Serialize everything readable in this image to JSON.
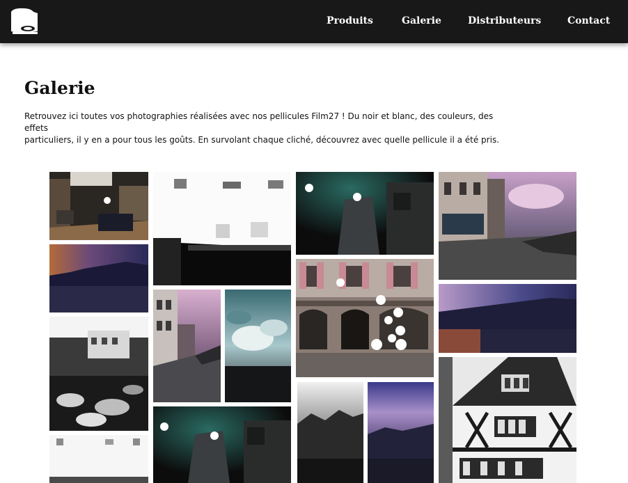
{
  "header": {
    "logo_name": "film27-logo",
    "nav": [
      {
        "label": "Produits"
      },
      {
        "label": "Galerie"
      },
      {
        "label": "Distributeurs"
      },
      {
        "label": "Contact"
      }
    ]
  },
  "page": {
    "title": "Galerie",
    "intro_line1": "Retrouvez ici toutes vos photographies réalisées avec nos pellicules Film27 ! Du noir et blanc, des couleurs, des effets",
    "intro_line2": "particuliers, il y en a pour tous les goûts. En survolant chaque cliché, découvrez avec quelle pellicule il a été pris."
  },
  "gallery": {
    "photos": [
      {
        "subject": "interior-room-color"
      },
      {
        "subject": "overexposed-bw-office"
      },
      {
        "subject": "dark-corridor-teal"
      },
      {
        "subject": "street-purple-sky"
      },
      {
        "subject": "sunset-town-purple"
      },
      {
        "subject": "town-facade-shutters"
      },
      {
        "subject": "street-pink-sky-narrow"
      },
      {
        "subject": "bw-sky-teal-clouds"
      },
      {
        "subject": "dusk-town-purple-wide"
      },
      {
        "subject": "bw-parking-cars"
      },
      {
        "subject": "bw-trees-dark"
      },
      {
        "subject": "purple-sky-town-narrow"
      },
      {
        "subject": "half-timbered-house-bw"
      },
      {
        "subject": "overexposed-bw-office-2"
      },
      {
        "subject": "dark-corridor-teal-2"
      }
    ]
  }
}
